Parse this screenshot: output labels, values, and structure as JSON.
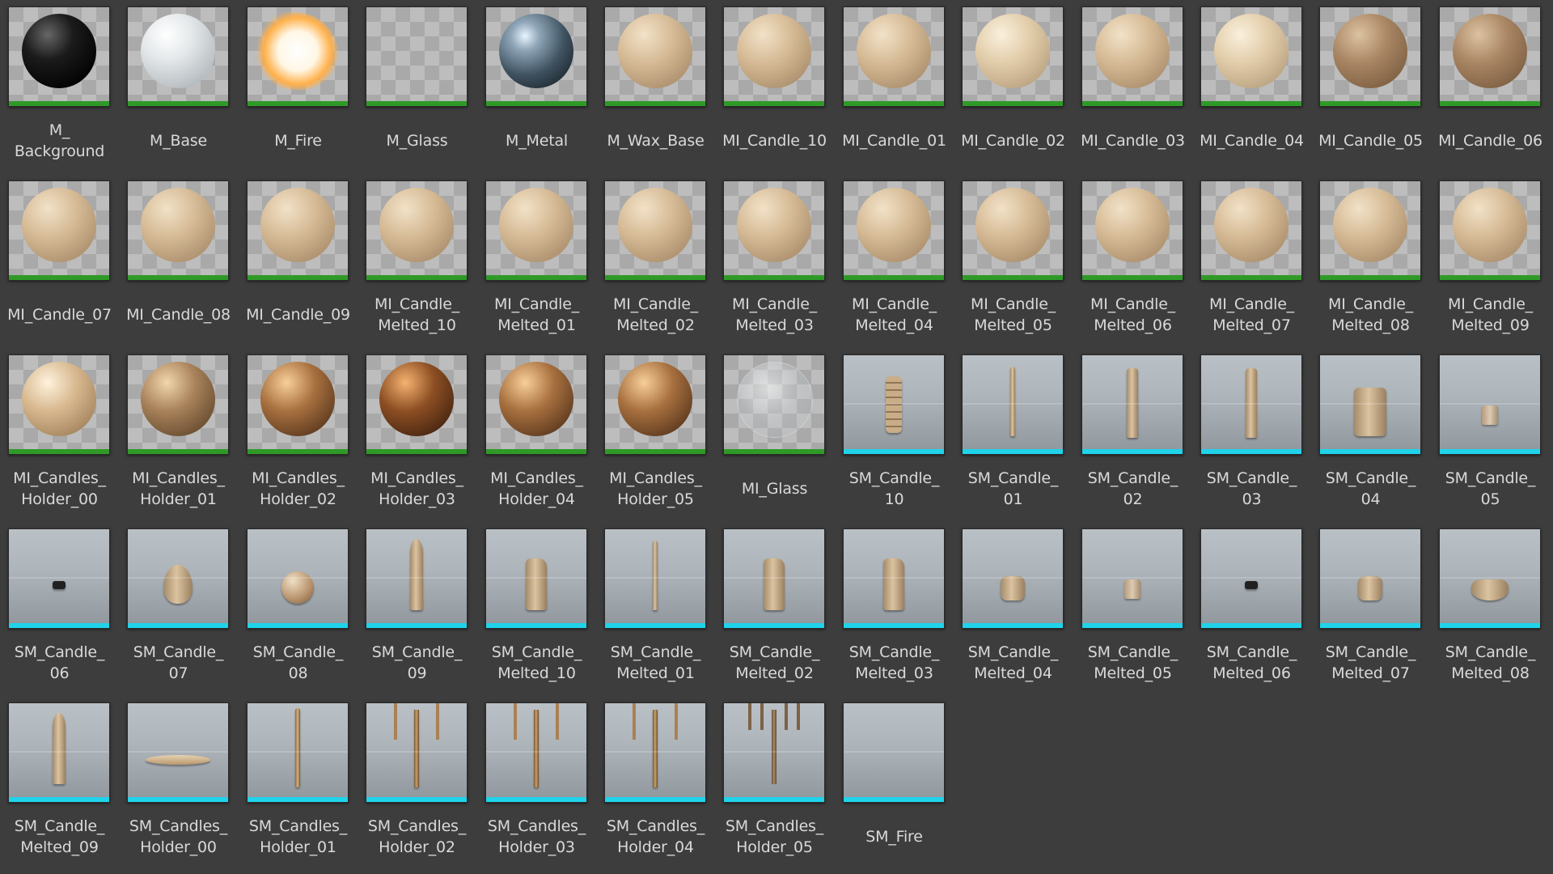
{
  "colors": {
    "background": "#3d3d3d",
    "material_bar": "#2f9a27",
    "mesh_bar": "#1fd3ea",
    "label_text": "#d9d9d9"
  },
  "assets": [
    {
      "label": "M_\nBackground",
      "type": "material",
      "icon": "sphere-black"
    },
    {
      "label": "M_Base",
      "type": "material",
      "icon": "sphere-white"
    },
    {
      "label": "M_Fire",
      "type": "material",
      "icon": "fire"
    },
    {
      "label": "M_Glass",
      "type": "material",
      "icon": "empty"
    },
    {
      "label": "M_Metal",
      "type": "material",
      "icon": "sphere-chrome"
    },
    {
      "label": "M_Wax_Base",
      "type": "material",
      "icon": "sphere-wax"
    },
    {
      "label": "MI_Candle_10",
      "type": "material",
      "icon": "sphere-wax"
    },
    {
      "label": "MI_Candle_01",
      "type": "material",
      "icon": "sphere-wax"
    },
    {
      "label": "MI_Candle_02",
      "type": "material",
      "icon": "sphere-wax-light"
    },
    {
      "label": "MI_Candle_03",
      "type": "material",
      "icon": "sphere-wax"
    },
    {
      "label": "MI_Candle_04",
      "type": "material",
      "icon": "sphere-wax-light"
    },
    {
      "label": "MI_Candle_05",
      "type": "material",
      "icon": "sphere-wax-dark"
    },
    {
      "label": "MI_Candle_06",
      "type": "material",
      "icon": "sphere-wax-dark"
    },
    {
      "label": "MI_Candle_07",
      "type": "material",
      "icon": "sphere-wax"
    },
    {
      "label": "MI_Candle_08",
      "type": "material",
      "icon": "sphere-wax"
    },
    {
      "label": "MI_Candle_09",
      "type": "material",
      "icon": "sphere-wax"
    },
    {
      "label": "MI_Candle_\nMelted_10",
      "type": "material",
      "icon": "sphere-wax"
    },
    {
      "label": "MI_Candle_\nMelted_01",
      "type": "material",
      "icon": "sphere-wax"
    },
    {
      "label": "MI_Candle_\nMelted_02",
      "type": "material",
      "icon": "sphere-wax"
    },
    {
      "label": "MI_Candle_\nMelted_03",
      "type": "material",
      "icon": "sphere-wax"
    },
    {
      "label": "MI_Candle_\nMelted_04",
      "type": "material",
      "icon": "sphere-wax"
    },
    {
      "label": "MI_Candle_\nMelted_05",
      "type": "material",
      "icon": "sphere-wax"
    },
    {
      "label": "MI_Candle_\nMelted_06",
      "type": "material",
      "icon": "sphere-wax"
    },
    {
      "label": "MI_Candle_\nMelted_07",
      "type": "material",
      "icon": "sphere-wax"
    },
    {
      "label": "MI_Candle_\nMelted_08",
      "type": "material",
      "icon": "sphere-wax"
    },
    {
      "label": "MI_Candle_\nMelted_09",
      "type": "material",
      "icon": "sphere-wax"
    },
    {
      "label": "MI_Candles_\nHolder_00",
      "type": "material",
      "icon": "sphere-brass-light"
    },
    {
      "label": "MI_Candles_\nHolder_01",
      "type": "material",
      "icon": "sphere-brass"
    },
    {
      "label": "MI_Candles_\nHolder_02",
      "type": "material",
      "icon": "sphere-bronze"
    },
    {
      "label": "MI_Candles_\nHolder_03",
      "type": "material",
      "icon": "sphere-copper"
    },
    {
      "label": "MI_Candles_\nHolder_04",
      "type": "material",
      "icon": "sphere-bronze"
    },
    {
      "label": "MI_Candles_\nHolder_05",
      "type": "material",
      "icon": "sphere-bronze"
    },
    {
      "label": "MI_Glass",
      "type": "material",
      "icon": "sphere-glass"
    },
    {
      "label": "SM_Candle_\n10",
      "type": "mesh",
      "icon": "candle-stack"
    },
    {
      "label": "SM_Candle_\n01",
      "type": "mesh",
      "icon": "candle-thin"
    },
    {
      "label": "SM_Candle_\n02",
      "type": "mesh",
      "icon": "candle-tall"
    },
    {
      "label": "SM_Candle_\n03",
      "type": "mesh",
      "icon": "candle-tall"
    },
    {
      "label": "SM_Candle_\n04",
      "type": "mesh",
      "icon": "candle-pillar"
    },
    {
      "label": "SM_Candle_\n05",
      "type": "mesh",
      "icon": "candle-glass"
    },
    {
      "label": "SM_Candle_\n06",
      "type": "mesh",
      "icon": "candle-tealight"
    },
    {
      "label": "SM_Candle_\n07",
      "type": "mesh",
      "icon": "candle-egg"
    },
    {
      "label": "SM_Candle_\n08",
      "type": "mesh",
      "icon": "candle-ball"
    },
    {
      "label": "SM_Candle_\n09",
      "type": "mesh",
      "icon": "candle-cone"
    },
    {
      "label": "SM_Candle_\nMelted_10",
      "type": "mesh",
      "icon": "candle-melted"
    },
    {
      "label": "SM_Candle_\nMelted_01",
      "type": "mesh",
      "icon": "candle-thin"
    },
    {
      "label": "SM_Candle_\nMelted_02",
      "type": "mesh",
      "icon": "candle-melted"
    },
    {
      "label": "SM_Candle_\nMelted_03",
      "type": "mesh",
      "icon": "candle-melted"
    },
    {
      "label": "SM_Candle_\nMelted_04",
      "type": "mesh",
      "icon": "candle-short"
    },
    {
      "label": "SM_Candle_\nMelted_05",
      "type": "mesh",
      "icon": "candle-glass"
    },
    {
      "label": "SM_Candle_\nMelted_06",
      "type": "mesh",
      "icon": "candle-tealight"
    },
    {
      "label": "SM_Candle_\nMelted_07",
      "type": "mesh",
      "icon": "candle-short"
    },
    {
      "label": "SM_Candle_\nMelted_08",
      "type": "mesh",
      "icon": "candle-bowl"
    },
    {
      "label": "SM_Candle_\nMelted_09",
      "type": "mesh",
      "icon": "candle-cone"
    },
    {
      "label": "SM_Candles_\nHolder_00",
      "type": "mesh",
      "icon": "holder-plate"
    },
    {
      "label": "SM_Candles_\nHolder_01",
      "type": "mesh",
      "icon": "holder-stick"
    },
    {
      "label": "SM_Candles_\nHolder_02",
      "type": "mesh",
      "icon": "holder-candelabra"
    },
    {
      "label": "SM_Candles_\nHolder_03",
      "type": "mesh",
      "icon": "holder-candelabra"
    },
    {
      "label": "SM_Candles_\nHolder_04",
      "type": "mesh",
      "icon": "holder-candelabra"
    },
    {
      "label": "SM_Candles_\nHolder_05",
      "type": "mesh",
      "icon": "holder-menorah"
    },
    {
      "label": "SM_Fire",
      "type": "mesh",
      "icon": "empty"
    }
  ]
}
